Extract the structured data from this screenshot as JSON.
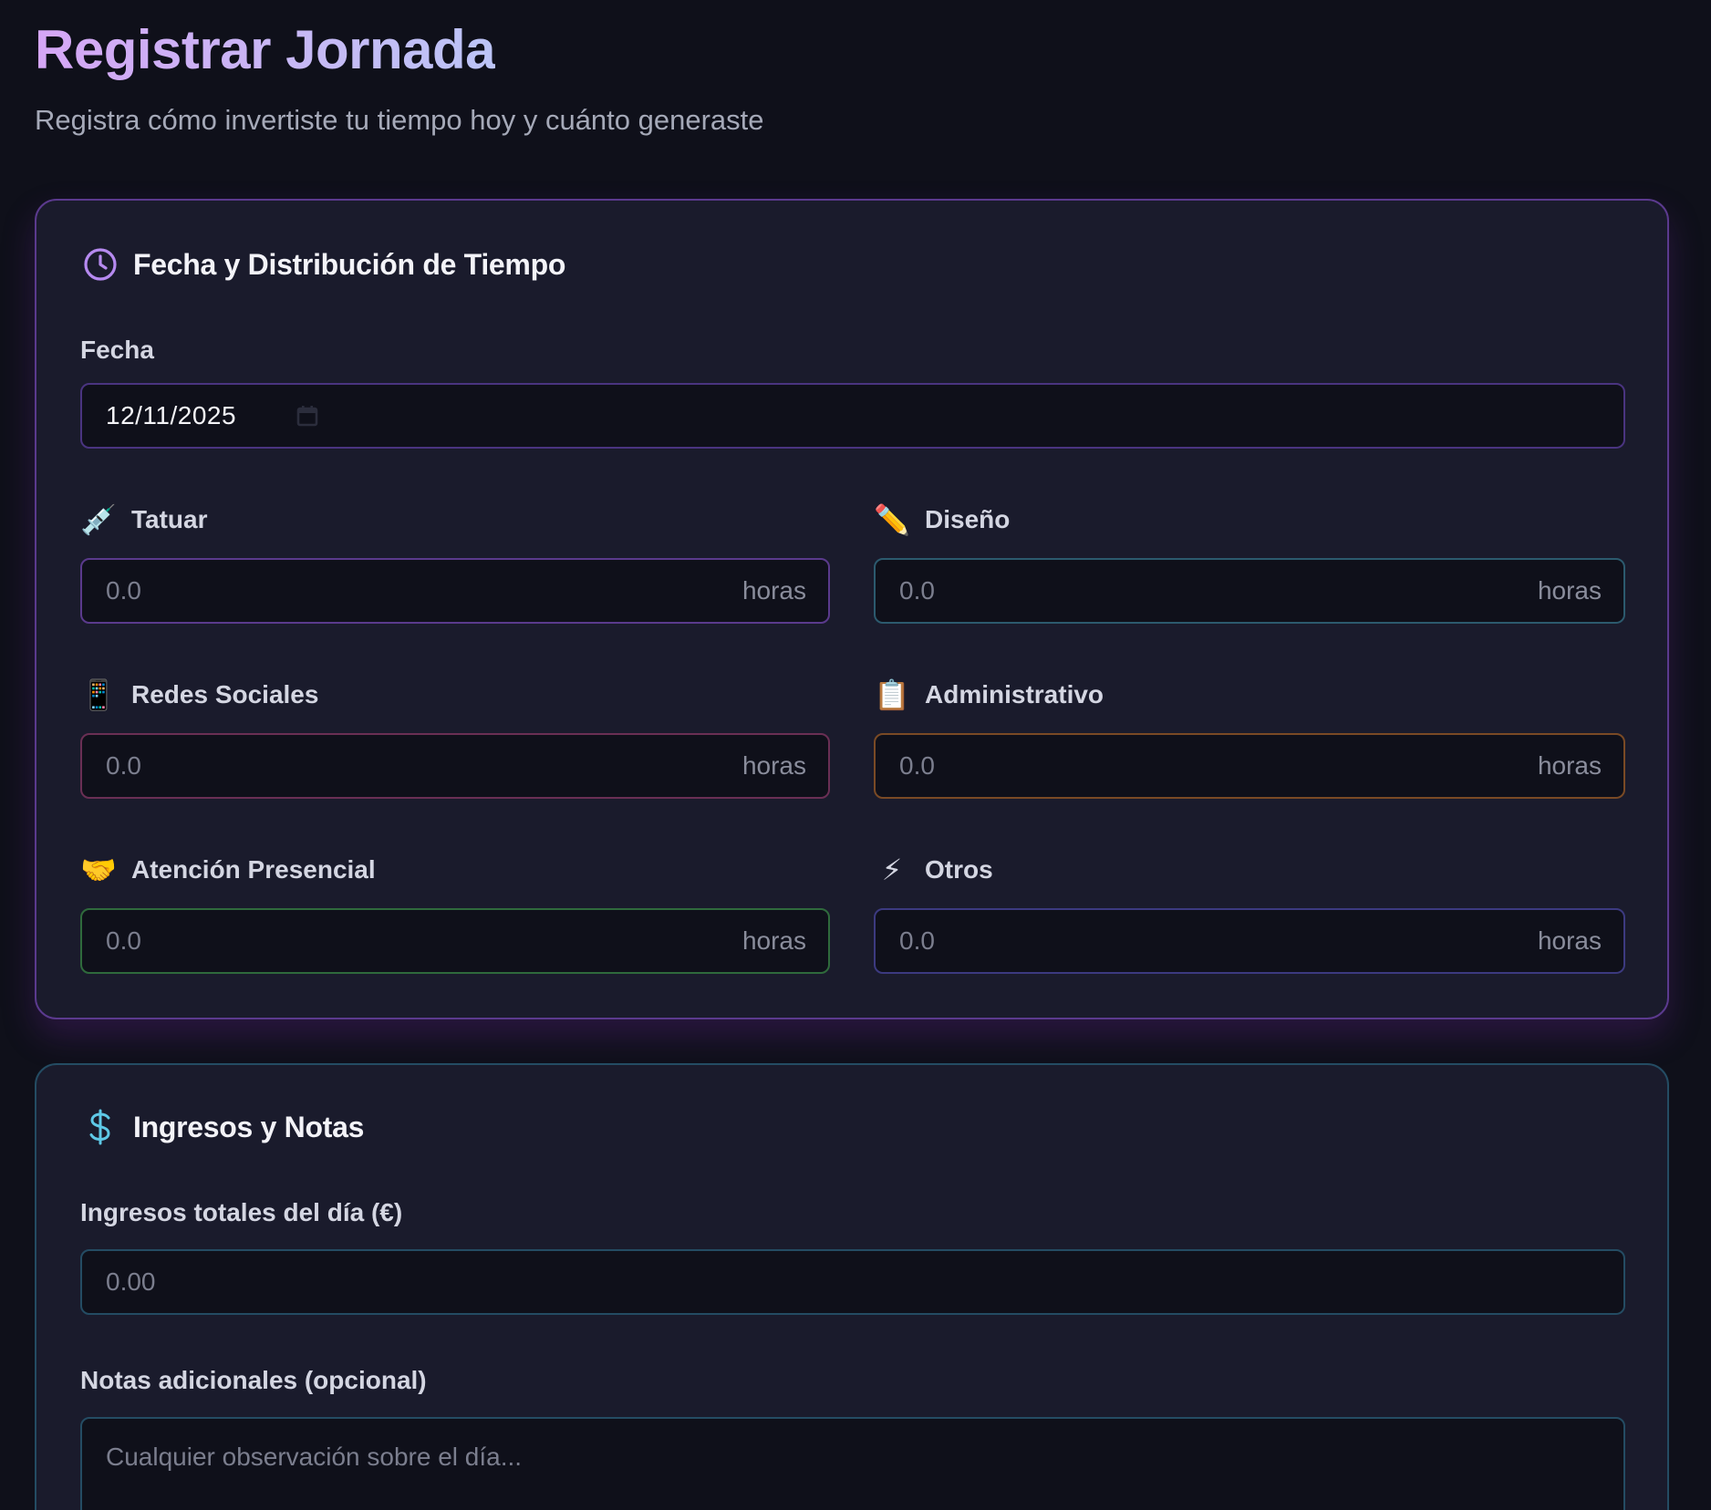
{
  "header": {
    "title": "Registrar Jornada",
    "subtitle": "Registra cómo invertiste tu tiempo hoy y cuánto generaste"
  },
  "time_card": {
    "title": "Fecha y Distribución de Tiempo",
    "icon": "clock-icon",
    "date": {
      "label": "Fecha",
      "value": "12/11/2025",
      "icon": "calendar-icon"
    },
    "activities": [
      {
        "label": "Tatuar",
        "emoji": "💉",
        "icon": "syringe-icon",
        "placeholder": "0.0",
        "unit": "horas",
        "border_color": "#5a3a8c"
      },
      {
        "label": "Diseño",
        "emoji": "✏️",
        "icon": "pencil-icon",
        "placeholder": "0.0",
        "unit": "horas",
        "border_color": "#2c5a6e"
      },
      {
        "label": "Redes Sociales",
        "emoji": "📱",
        "icon": "phone-icon",
        "placeholder": "0.0",
        "unit": "horas",
        "border_color": "#6a2f54"
      },
      {
        "label": "Administrativo",
        "emoji": "📋",
        "icon": "clipboard-icon",
        "placeholder": "0.0",
        "unit": "horas",
        "border_color": "#7a4a25"
      },
      {
        "label": "Atención Presencial",
        "emoji": "🤝",
        "icon": "handshake-icon",
        "placeholder": "0.0",
        "unit": "horas",
        "border_color": "#2f6a3c"
      },
      {
        "label": "Otros",
        "emoji": "⚡",
        "icon": "lightning-icon",
        "placeholder": "0.0",
        "unit": "horas",
        "border_color": "#3c3a80"
      }
    ]
  },
  "income_card": {
    "title": "Ingresos y Notas",
    "icon": "dollar-icon",
    "income": {
      "label": "Ingresos totales del día (€)",
      "placeholder": "0.00"
    },
    "notes": {
      "label": "Notas adicionales (opcional)",
      "placeholder": "Cualquier observación sobre el día..."
    }
  },
  "colors": {
    "background": "#0f101a",
    "card": "#1a1b2c",
    "accent_purple": "#b68af0",
    "accent_cyan": "#5ec8e6"
  }
}
